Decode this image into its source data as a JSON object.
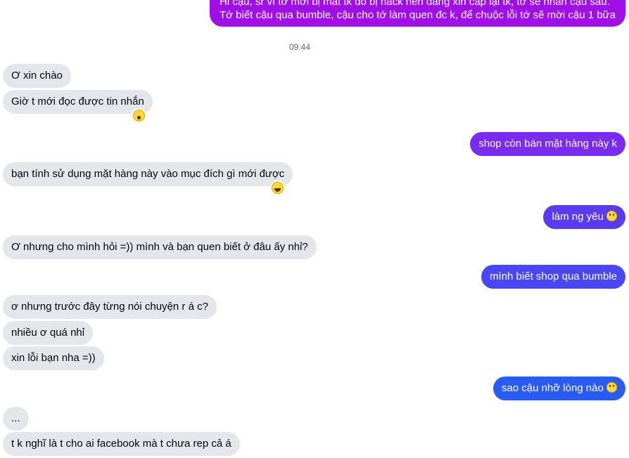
{
  "timestamp": "09:44",
  "colors": {
    "incoming_bg": "#e4e6eb",
    "outgoing_purple": "#a00ee8",
    "outgoing_violet": "#7a2bf0",
    "outgoing_indigo": "#5b3bf2",
    "outgoing_blue": "#3f4ef0",
    "outgoing_deepblue": "#2a5cf5"
  },
  "messages": [
    {
      "id": "m0",
      "direction": "out",
      "lines": [
        "Hi cậu, sr vì tớ mới bị mất tk do bị hack nên đang xin cấp lại tk, tớ sẽ nhắn cậu sau.",
        "Tớ biết cậu qua bumble, cậu cho tớ làm quen đc k, để chuộc lỗi tớ sẽ mời cậu 1 bữa"
      ]
    },
    {
      "id": "m1",
      "direction": "in",
      "text": "Ơ xin chào"
    },
    {
      "id": "m2",
      "direction": "in",
      "text": "Giờ t mới đọc được tin nhắn",
      "reaction": "wow"
    },
    {
      "id": "m3",
      "direction": "out",
      "text": "shop còn bán mặt hàng này k"
    },
    {
      "id": "m4",
      "direction": "in",
      "text": "bạn tính sử dụng mặt hàng này vào mục đích gì mới được",
      "reaction": "haha"
    },
    {
      "id": "m5",
      "direction": "out",
      "text": "làm ng yêu",
      "emoji": "slight-smile"
    },
    {
      "id": "m6",
      "direction": "in",
      "text": "Ơ nhưng cho mình hỏi =)) mình và bạn quen biết ở đâu ấy nhỉ?"
    },
    {
      "id": "m7",
      "direction": "out",
      "text": "mình biết shop qua bumble"
    },
    {
      "id": "m8",
      "direction": "in",
      "text": "ơ nhưng trước đây từng nói chuyện r á c?"
    },
    {
      "id": "m9",
      "direction": "in",
      "text": "nhiều ơ quá nhỉ"
    },
    {
      "id": "m10",
      "direction": "in",
      "text": "xin lỗi bạn nha =))"
    },
    {
      "id": "m11",
      "direction": "out",
      "text": "sao cậu nhỡ lòng nào",
      "emoji": "slight-smile"
    },
    {
      "id": "m12",
      "direction": "in",
      "text": "..."
    },
    {
      "id": "m13",
      "direction": "in",
      "text": "t k nghĩ là t cho ai facebook mà t chưa rep cả á"
    }
  ]
}
